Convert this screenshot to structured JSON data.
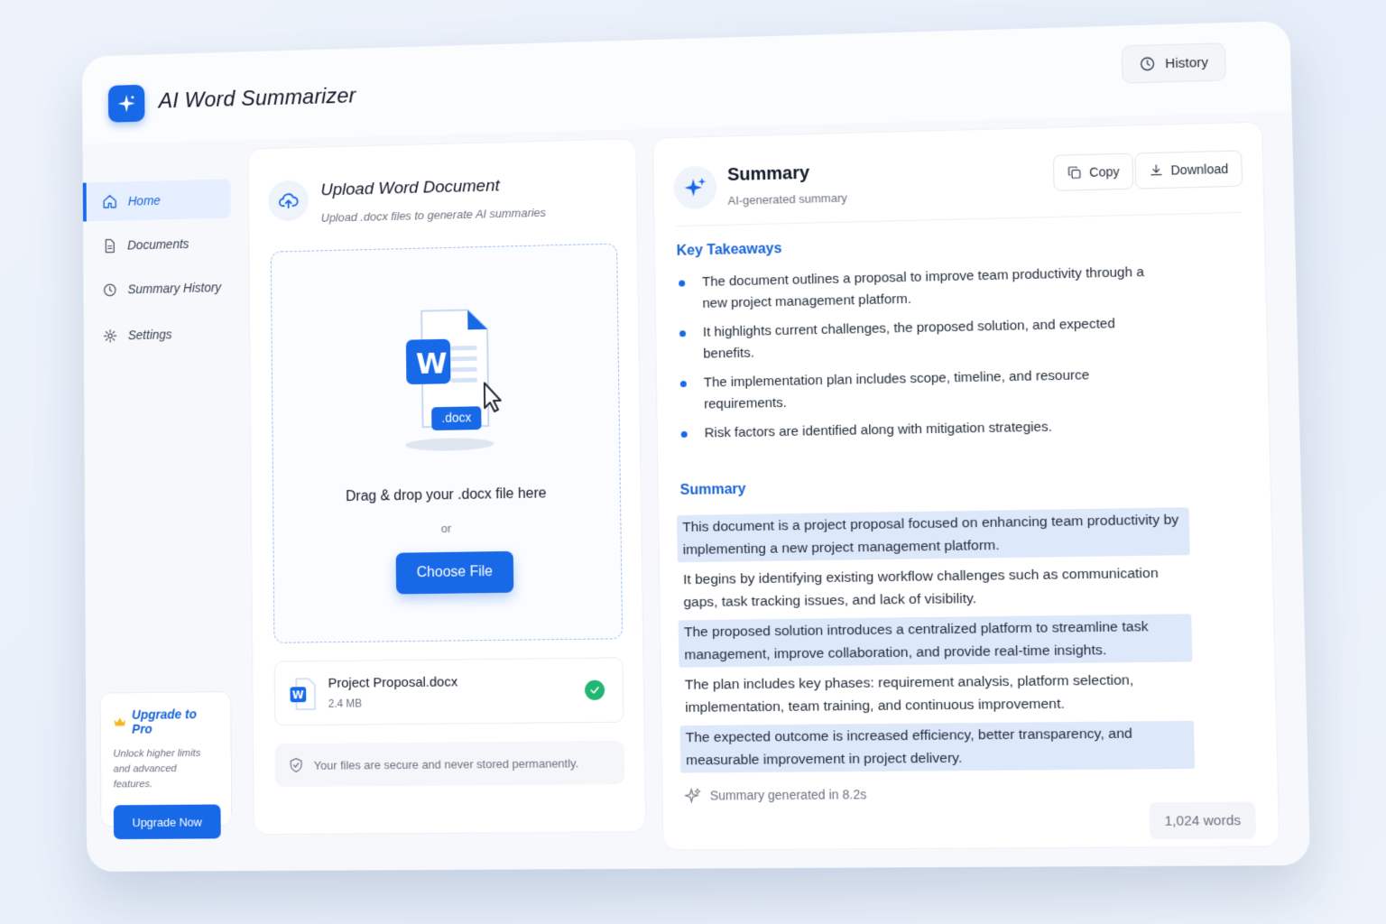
{
  "app": {
    "title": "AI Word Summarizer",
    "history_label": "History"
  },
  "sidebar": {
    "items": [
      {
        "label": "Home",
        "icon": "home-icon",
        "active": true
      },
      {
        "label": "Documents",
        "icon": "document-icon",
        "active": false
      },
      {
        "label": "Summary History",
        "icon": "history-icon",
        "active": false
      },
      {
        "label": "Settings",
        "icon": "gear-icon",
        "active": false
      }
    ],
    "upgrade": {
      "title": "Upgrade to Pro",
      "text": "Unlock higher limits and advanced features.",
      "button": "Upgrade Now"
    }
  },
  "upload": {
    "title": "Upload Word Document",
    "subtitle": "Upload .docx files to generate AI summaries",
    "badge": ".docx",
    "word_letter": "W",
    "drop_text": "Drag & drop your .docx file here",
    "or_text": "or",
    "choose_button": "Choose File",
    "file": {
      "name": "Project Proposal.docx",
      "size": "2.4 MB",
      "status": "uploaded"
    },
    "secure_note": "Your files are secure and never stored permanently."
  },
  "summary": {
    "title": "Summary",
    "subtitle": "AI-generated summary",
    "copy_label": "Copy",
    "download_label": "Download",
    "takeaways_heading": "Key Takeaways",
    "takeaways": [
      "The document outlines a proposal to improve team productivity through a new project management platform.",
      "It highlights current challenges, the proposed solution, and expected benefits.",
      "The implementation plan includes scope, timeline, and resource requirements.",
      "Risk factors are identified along with mitigation strategies."
    ],
    "summary_heading": "Summary",
    "paragraphs": [
      {
        "text": "This document is a project proposal focused on enhancing team productivity by implementing a new project management platform.",
        "highlighted": true
      },
      {
        "text": "It begins by identifying existing workflow challenges such as communication gaps, task tracking issues, and lack of visibility.",
        "highlighted": false
      },
      {
        "text": "The proposed solution introduces a centralized platform to streamline task management, improve collaboration, and provide real-time insights.",
        "highlighted": true
      },
      {
        "text": "The plan includes key phases: requirement analysis, platform selection, implementation, team training, and continuous improvement.",
        "highlighted": false
      },
      {
        "text": "The expected outcome is increased efficiency, better transparency, and measurable improvement in project delivery.",
        "highlighted": true
      }
    ],
    "generated_text": "Summary generated in 8.2s",
    "word_count": "1,024 words"
  },
  "colors": {
    "accent": "#1769e8",
    "highlight": "#dde8fb",
    "success": "#22b573"
  }
}
